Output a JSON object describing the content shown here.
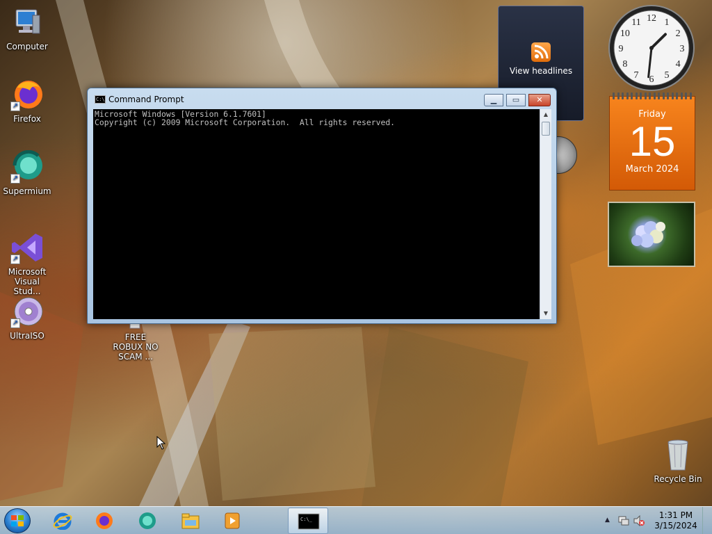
{
  "desktop": {
    "icons": [
      {
        "label": "Computer",
        "icon": "computer-icon"
      },
      {
        "label": "Firefox",
        "icon": "firefox-icon"
      },
      {
        "label": "Supermium",
        "icon": "supermium-icon"
      },
      {
        "label": "Microsoft Visual Stud...",
        "icon": "visual-studio-icon"
      },
      {
        "label": "UltraISO",
        "icon": "ultraiso-icon"
      },
      {
        "label": "FREE ROBUX NO SCAM ...",
        "icon": "file-icon"
      },
      {
        "label": "Recycle Bin",
        "icon": "recycle-bin-icon"
      }
    ]
  },
  "gadgets": {
    "rss": {
      "label": "View headlines"
    },
    "clock": {
      "hour": 1,
      "minute": 31,
      "numerals": [
        "12",
        "1",
        "2",
        "3",
        "4",
        "5",
        "6",
        "7",
        "8",
        "9",
        "10",
        "11"
      ]
    },
    "calendar": {
      "weekday": "Friday",
      "day": "15",
      "month_year": "March 2024"
    }
  },
  "cmd_window": {
    "title": "Command Prompt",
    "icon_text": "C:\\_",
    "lines": [
      "Microsoft Windows [Version 6.1.7601]",
      "Copyright (c) 2009 Microsoft Corporation.  All rights reserved."
    ]
  },
  "taskbar": {
    "pinned": [
      "internet-explorer-icon",
      "firefox-icon",
      "supermium-icon",
      "file-explorer-icon",
      "media-player-icon"
    ],
    "active": "command-prompt-icon",
    "tray": {
      "time": "1:31 PM",
      "date": "3/15/2024"
    }
  },
  "colors": {
    "console_bg": "#000000",
    "console_fg": "#c0c0c0",
    "calendar_orange": "#f07a18",
    "start_orb": "#2a7fd0"
  }
}
